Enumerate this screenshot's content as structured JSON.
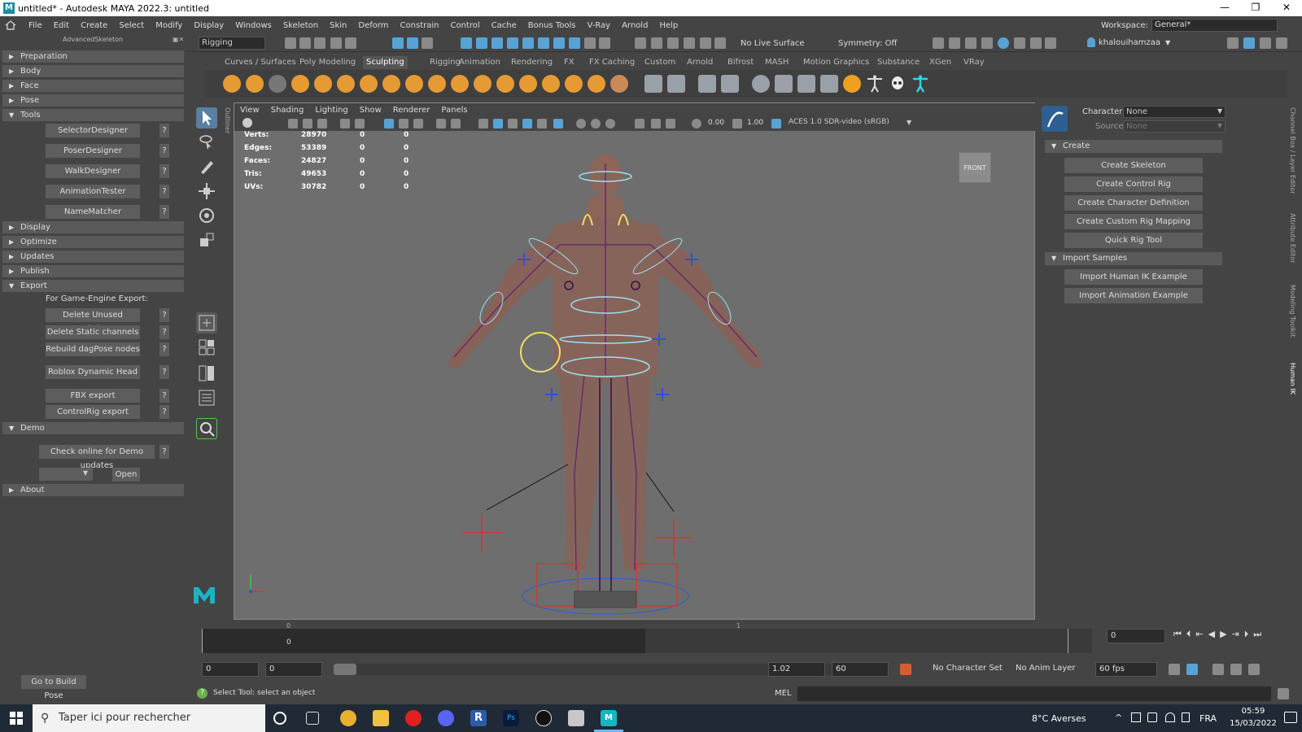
{
  "window": {
    "title": "untitled* - Autodesk MAYA 2022.3: untitled",
    "controls": [
      "—",
      "❐",
      "✕"
    ]
  },
  "menubar": {
    "items": [
      "File",
      "Edit",
      "Create",
      "Select",
      "Modify",
      "Display",
      "Windows",
      "Skeleton",
      "Skin",
      "Deform",
      "Constrain",
      "Control",
      "Cache",
      "Bonus Tools",
      "V-Ray",
      "Arnold",
      "Help"
    ],
    "workspace_label": "Workspace:",
    "workspace_value": "General*"
  },
  "statusline": {
    "menuset": "Rigging",
    "live_surface": "No Live Surface",
    "symmetry": "Symmetry: Off",
    "user": "khalouihamzaa"
  },
  "advanced_skeleton": {
    "title": "AdvancedSkeleton",
    "sections": {
      "preparation": "Preparation",
      "body": "Body",
      "face": "Face",
      "pose": "Pose",
      "tools": "Tools",
      "display": "Display",
      "optimize": "Optimize",
      "updates": "Updates",
      "publish": "Publish",
      "export": "Export",
      "demo": "Demo",
      "about": "About"
    },
    "tools_buttons": [
      "SelectorDesigner",
      "PoserDesigner",
      "WalkDesigner",
      "AnimationTester",
      "NameMatcher"
    ],
    "export_label": "For Game-Engine Export:",
    "export_buttons": [
      "Delete Unused Endjoints",
      "Delete Static channels",
      "Rebuild dagPose nodes",
      "Roblox Dynamic Head",
      "FBX export",
      "ControlRig export"
    ],
    "help": "?",
    "demo_check": "Check online for Demo updates",
    "demo_open": "Open",
    "build_pose": "Go to Build Pose"
  },
  "shelf": {
    "tabs": [
      "Curves / Surfaces",
      "Poly Modeling",
      "Sculpting",
      "Rigging",
      "Animation",
      "Rendering",
      "FX",
      "FX Caching",
      "Custom",
      "Arnold",
      "Bifrost",
      "MASH",
      "Motion Graphics",
      "Substance",
      "XGen",
      "VRay"
    ],
    "active_tab": "Sculpting"
  },
  "viewport": {
    "outliner_label": "Outliner",
    "menu": [
      "View",
      "Shading",
      "Lighting",
      "Show",
      "Renderer",
      "Panels"
    ],
    "exposure": "0.00",
    "gamma": "1.00",
    "color_space": "ACES 1.0 SDR-video (sRGB)",
    "view_cube": "FRONT",
    "hud": [
      {
        "label": "Verts:",
        "v1": "28970",
        "v2": "0",
        "v3": "0"
      },
      {
        "label": "Edges:",
        "v1": "53389",
        "v2": "0",
        "v3": "0"
      },
      {
        "label": "Faces:",
        "v1": "24827",
        "v2": "0",
        "v3": "0"
      },
      {
        "label": "Tris:",
        "v1": "49653",
        "v2": "0",
        "v3": "0"
      },
      {
        "label": "UVs:",
        "v1": "30782",
        "v2": "0",
        "v3": "0"
      }
    ]
  },
  "human_ik": {
    "character_label": "Character:",
    "character_value": "None",
    "source_label": "Source:",
    "source_value": "None",
    "create_section": "Create",
    "create_buttons": [
      "Create Skeleton",
      "Create Control Rig",
      "Create Character Definition",
      "Create Custom Rig Mapping",
      "Quick Rig Tool"
    ],
    "import_section": "Import Samples",
    "import_buttons": [
      "Import Human IK Example",
      "Import Animation Example"
    ],
    "side_tabs": [
      "Channel Box / Layer Editor",
      "Attribute Editor",
      "Modeling Toolkit",
      "Human IK"
    ]
  },
  "timeline": {
    "tick_0": "0",
    "tick_1": "1",
    "current_label": "0",
    "current_frame": "0"
  },
  "range": {
    "start": "0",
    "playback_start": "0",
    "playback_end": "1.02",
    "end": "60",
    "character_set": "No Character Set",
    "anim_layer": "No Anim Layer",
    "fps": "60 fps"
  },
  "helpline": {
    "text": "Select Tool: select an object",
    "mel": "MEL"
  },
  "taskbar": {
    "search": "Taper ici pour rechercher",
    "weather": "8°C  Averses",
    "lang": "FRA",
    "time": "05:59",
    "date": "15/03/2022"
  },
  "colors": {
    "accent": "#57a3d6",
    "sculpt": "#e59a34",
    "joint": "#7a2e7a",
    "control_yellow": "#f0e060",
    "control_cyan": "#9fe0f0",
    "ik_red": "#e03030"
  }
}
